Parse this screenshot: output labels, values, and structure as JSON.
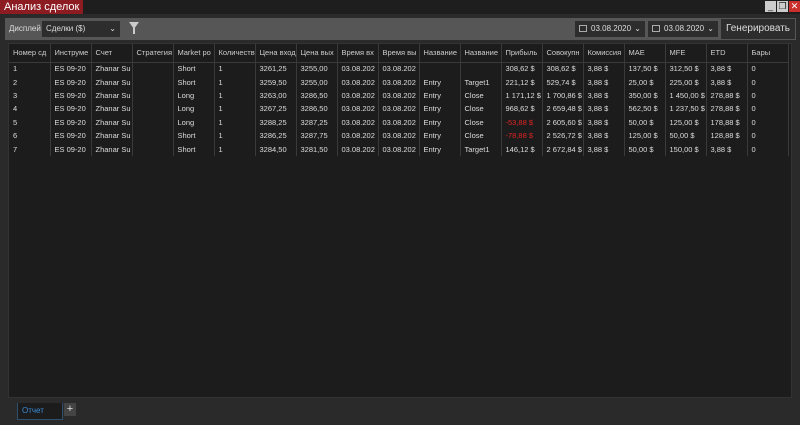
{
  "window": {
    "title": "Анализ сделок"
  },
  "toolbar": {
    "display_label": "Дисплей",
    "display_value": "Сделки ($)",
    "date_from": "03.08.2020",
    "date_to": "03.08.2020",
    "generate_label": "Генерировать"
  },
  "table": {
    "columns": [
      "Номер сд",
      "Инструме",
      "Счет",
      "Стратегия",
      "Market po",
      "Количеств",
      "Цена вход",
      "Цена вых",
      "Время вх",
      "Время вы",
      "Название",
      "Название",
      "Прибыль",
      "Совокупн",
      "Комиссия",
      "MAE",
      "MFE",
      "ETD",
      "Бары"
    ],
    "rows": [
      [
        "1",
        "ES 09-20",
        "Zhanar Su",
        "",
        "Short",
        "1",
        "3261,25",
        "3255,00",
        "03.08.202",
        "03.08.202",
        "",
        "",
        "308,62 $",
        "308,62 $",
        "3,88 $",
        "137,50 $",
        "312,50 $",
        "3,88 $",
        "0"
      ],
      [
        "2",
        "ES 09-20",
        "Zhanar Su",
        "",
        "Short",
        "1",
        "3259,50",
        "3255,00",
        "03.08.202",
        "03.08.202",
        "Entry",
        "Target1",
        "221,12 $",
        "529,74 $",
        "3,88 $",
        "25,00 $",
        "225,00 $",
        "3,88 $",
        "0"
      ],
      [
        "3",
        "ES 09-20",
        "Zhanar Su",
        "",
        "Long",
        "1",
        "3263,00",
        "3286,50",
        "03.08.202",
        "03.08.202",
        "Entry",
        "Close",
        "1 171,12 $",
        "1 700,86 $",
        "3,88 $",
        "350,00 $",
        "1 450,00 $",
        "278,88 $",
        "0"
      ],
      [
        "4",
        "ES 09-20",
        "Zhanar Su",
        "",
        "Long",
        "1",
        "3267,25",
        "3286,50",
        "03.08.202",
        "03.08.202",
        "Entry",
        "Close",
        "968,62 $",
        "2 659,48 $",
        "3,88 $",
        "562,50 $",
        "1 237,50 $",
        "278,88 $",
        "0"
      ],
      [
        "5",
        "ES 09-20",
        "Zhanar Su",
        "",
        "Long",
        "1",
        "3288,25",
        "3287,25",
        "03.08.202",
        "03.08.202",
        "Entry",
        "Close",
        "-53,88 $",
        "2 605,60 $",
        "3,88 $",
        "50,00 $",
        "125,00 $",
        "178,88 $",
        "0"
      ],
      [
        "6",
        "ES 09-20",
        "Zhanar Su",
        "",
        "Short",
        "1",
        "3286,25",
        "3287,75",
        "03.08.202",
        "03.08.202",
        "Entry",
        "Close",
        "-78,88 $",
        "2 526,72 $",
        "3,88 $",
        "125,00 $",
        "50,00 $",
        "128,88 $",
        "0"
      ],
      [
        "7",
        "ES 09-20",
        "Zhanar Su",
        "",
        "Short",
        "1",
        "3284,50",
        "3281,50",
        "03.08.202",
        "03.08.202",
        "Entry",
        "Target1",
        "146,12 $",
        "2 672,84 $",
        "3,88 $",
        "50,00 $",
        "150,00 $",
        "3,88 $",
        "0"
      ]
    ]
  },
  "tabs": {
    "active": "Отчет",
    "add": "+"
  },
  "colors": {
    "title_bg": "#8c1b22",
    "negative": "#e02424",
    "tab_active": "#3a8ad8"
  }
}
